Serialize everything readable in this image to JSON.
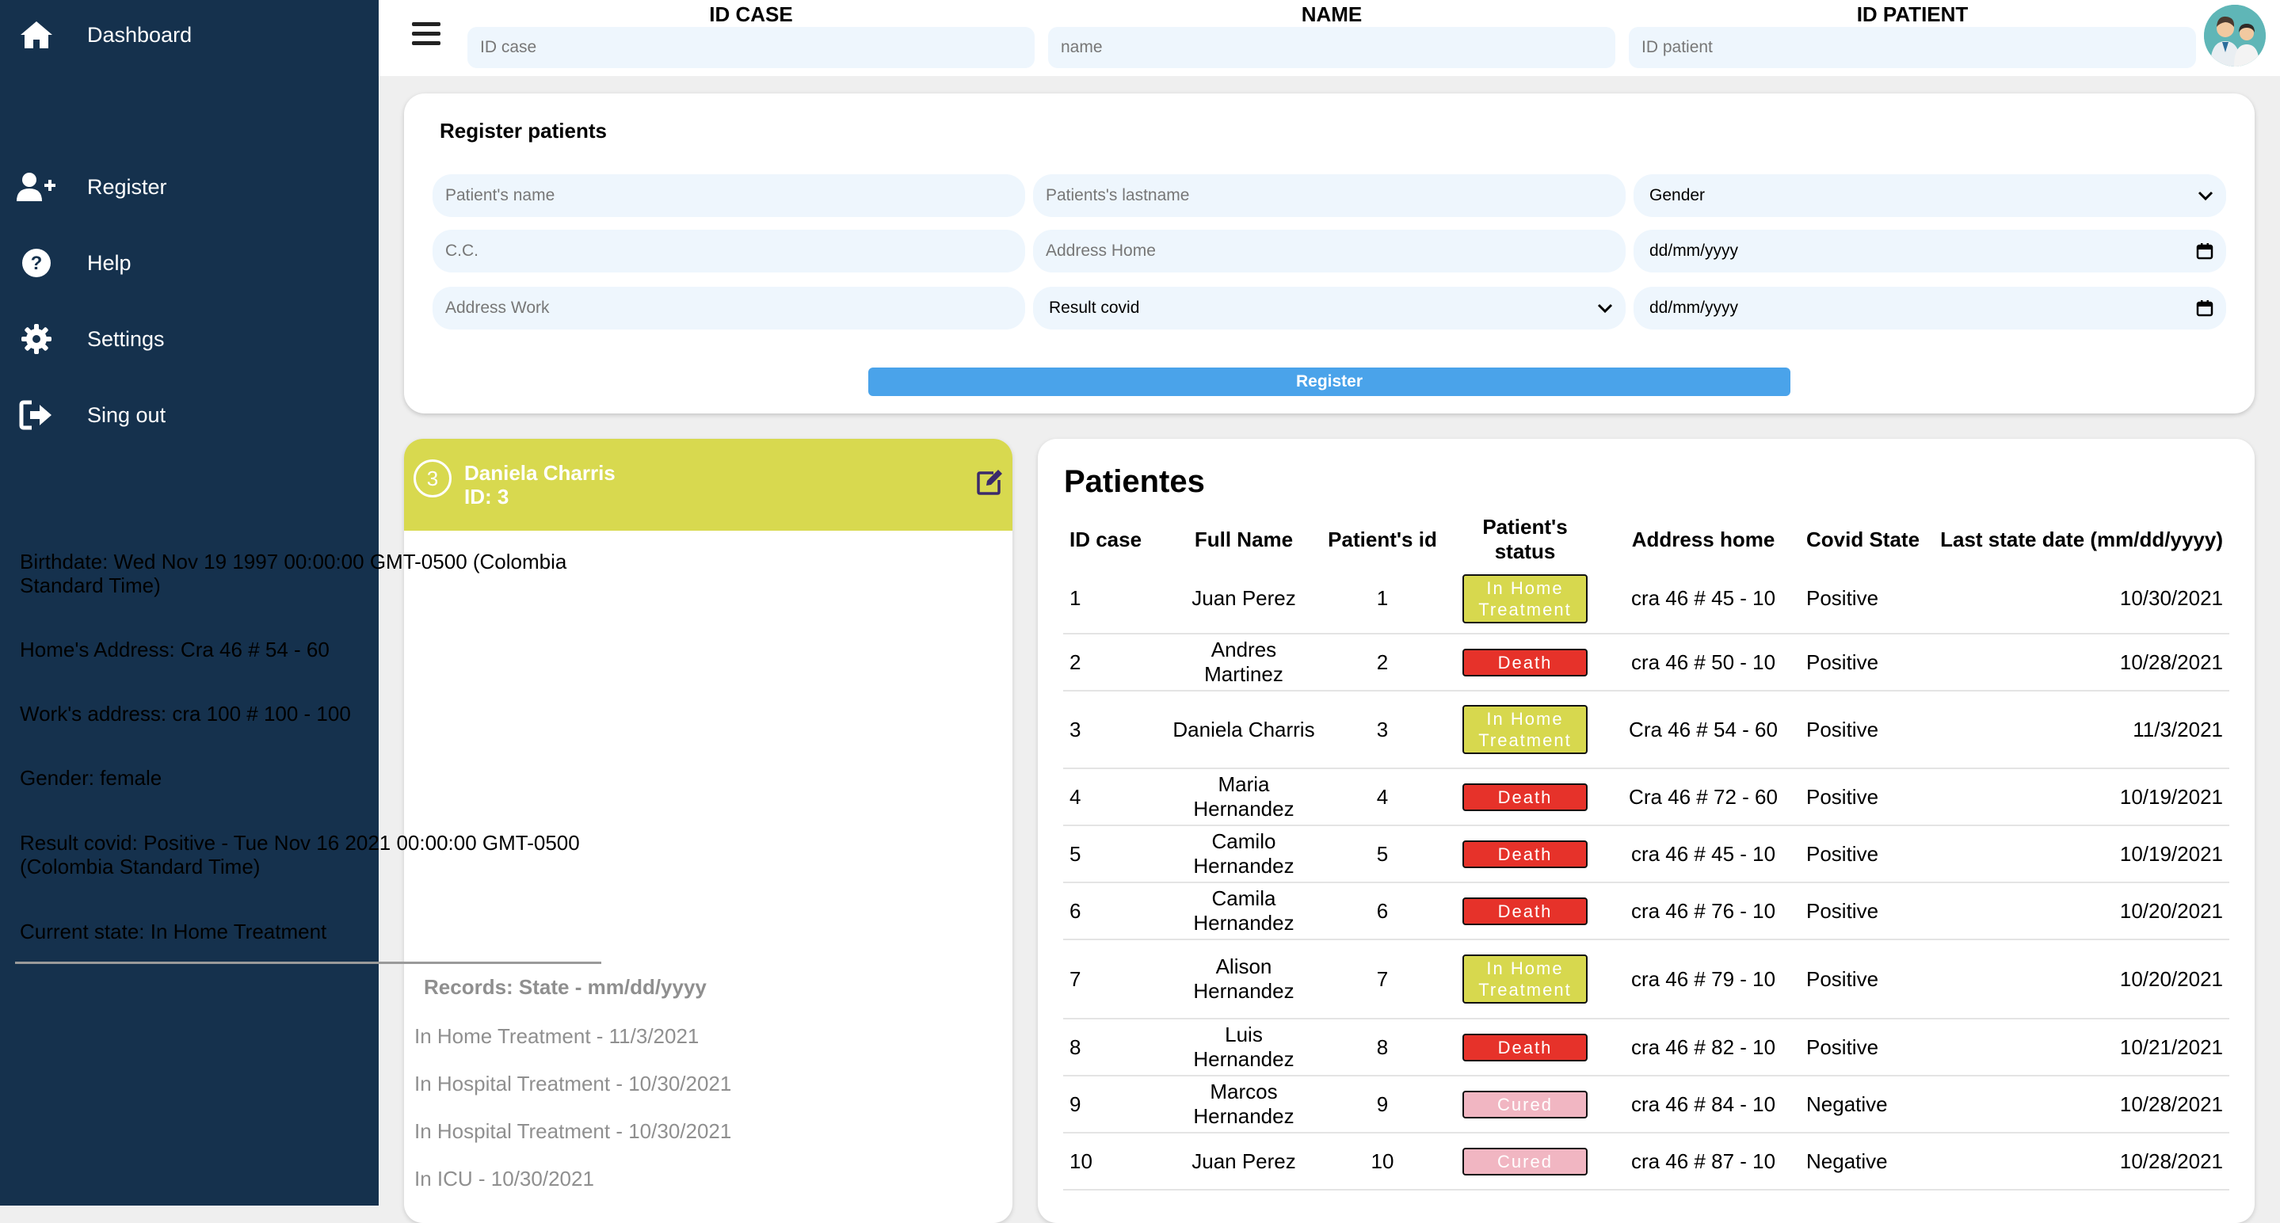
{
  "sidebar": {
    "items": [
      {
        "label": "Dashboard",
        "icon": "home-icon"
      },
      {
        "label": "Register",
        "icon": "user-plus-icon"
      },
      {
        "label": "Help",
        "icon": "question-circle-icon"
      },
      {
        "label": "Settings",
        "icon": "gear-icon"
      },
      {
        "label": "Sing out",
        "icon": "sign-out-icon"
      }
    ]
  },
  "search": {
    "id_case_label": "ID CASE",
    "id_case_placeholder": "ID case",
    "name_label": "NAME",
    "name_placeholder": "name",
    "id_patient_label": "ID PATIENT",
    "id_patient_placeholder": "ID patient"
  },
  "register": {
    "title": "Register patients",
    "name_placeholder": "Patient's name",
    "lastname_placeholder": "Patients's lastname",
    "gender_label": "Gender",
    "cc_placeholder": "C.C.",
    "address_home_placeholder": "Address Home",
    "birthdate_placeholder": "dd/mm/yyyy",
    "address_work_placeholder": "Address Work",
    "result_label": "Result covid",
    "result_date_placeholder": "dd/mm/yyyy",
    "button": "Register"
  },
  "detail": {
    "case_number": "3",
    "name": "Daniela Charris",
    "id_line": "ID: 3",
    "birthdate": "Birthdate: Wed Nov 19 1997 00:00:00 GMT-0500 (Colombia Standard Time)",
    "home_address": "Home's Address: Cra 46 # 54 - 60",
    "work_address": "Work's address: cra 100 # 100 - 100",
    "gender": "Gender: female",
    "result": "Result covid: Positive - Tue Nov 16 2021 00:00:00 GMT-0500 (Colombia Standard Time)",
    "current_state": "Current state: In Home Treatment",
    "records_title": "Records: State - mm/dd/yyyy",
    "records": [
      "In Home Treatment - 11/3/2021",
      "In Hospital Treatment - 10/30/2021",
      "In Hospital Treatment - 10/30/2021",
      "In ICU - 10/30/2021"
    ]
  },
  "table": {
    "title": "Patientes",
    "headers": [
      "ID case",
      "Full Name",
      "Patient's id",
      "Patient's status",
      "Address home",
      "Covid State",
      "Last state date (mm/dd/yyyy)"
    ],
    "rows": [
      {
        "id": "1",
        "name": "Juan Perez",
        "pid": "1",
        "status": "In Home Treatment",
        "address": "cra 46 # 45 - 10",
        "covid": "Positive",
        "date": "10/30/2021"
      },
      {
        "id": "2",
        "name": "Andres Martinez",
        "pid": "2",
        "status": "Death",
        "address": "cra 46 # 50 - 10",
        "covid": "Positive",
        "date": "10/28/2021"
      },
      {
        "id": "3",
        "name": "Daniela Charris",
        "pid": "3",
        "status": "In Home Treatment",
        "address": "Cra 46 # 54 - 60",
        "covid": "Positive",
        "date": "11/3/2021"
      },
      {
        "id": "4",
        "name": "Maria Hernandez",
        "pid": "4",
        "status": "Death",
        "address": "Cra 46 # 72 - 60",
        "covid": "Positive",
        "date": "10/19/2021"
      },
      {
        "id": "5",
        "name": "Camilo Hernandez",
        "pid": "5",
        "status": "Death",
        "address": "cra 46 # 45 - 10",
        "covid": "Positive",
        "date": "10/19/2021"
      },
      {
        "id": "6",
        "name": "Camila Hernandez",
        "pid": "6",
        "status": "Death",
        "address": "cra 46 # 76 - 10",
        "covid": "Positive",
        "date": "10/20/2021"
      },
      {
        "id": "7",
        "name": "Alison Hernandez",
        "pid": "7",
        "status": "In Home Treatment",
        "address": "cra 46 # 79 - 10",
        "covid": "Positive",
        "date": "10/20/2021"
      },
      {
        "id": "8",
        "name": "Luis Hernandez",
        "pid": "8",
        "status": "Death",
        "address": "cra 46 # 82 - 10",
        "covid": "Positive",
        "date": "10/21/2021"
      },
      {
        "id": "9",
        "name": "Marcos Hernandez",
        "pid": "9",
        "status": "Cured",
        "address": "cra 46 # 84 - 10",
        "covid": "Negative",
        "date": "10/28/2021"
      },
      {
        "id": "10",
        "name": "Juan Perez",
        "pid": "10",
        "status": "Cured",
        "address": "cra 46 # 87 - 10",
        "covid": "Negative",
        "date": "10/28/2021"
      }
    ]
  },
  "colors": {
    "sidebar": "#15314d",
    "accent_blue": "#4aa3ea",
    "home_treatment": "#d7d84e",
    "death": "#e6322a",
    "cured": "#f1b6c2",
    "input_bg": "#eef6fd"
  }
}
